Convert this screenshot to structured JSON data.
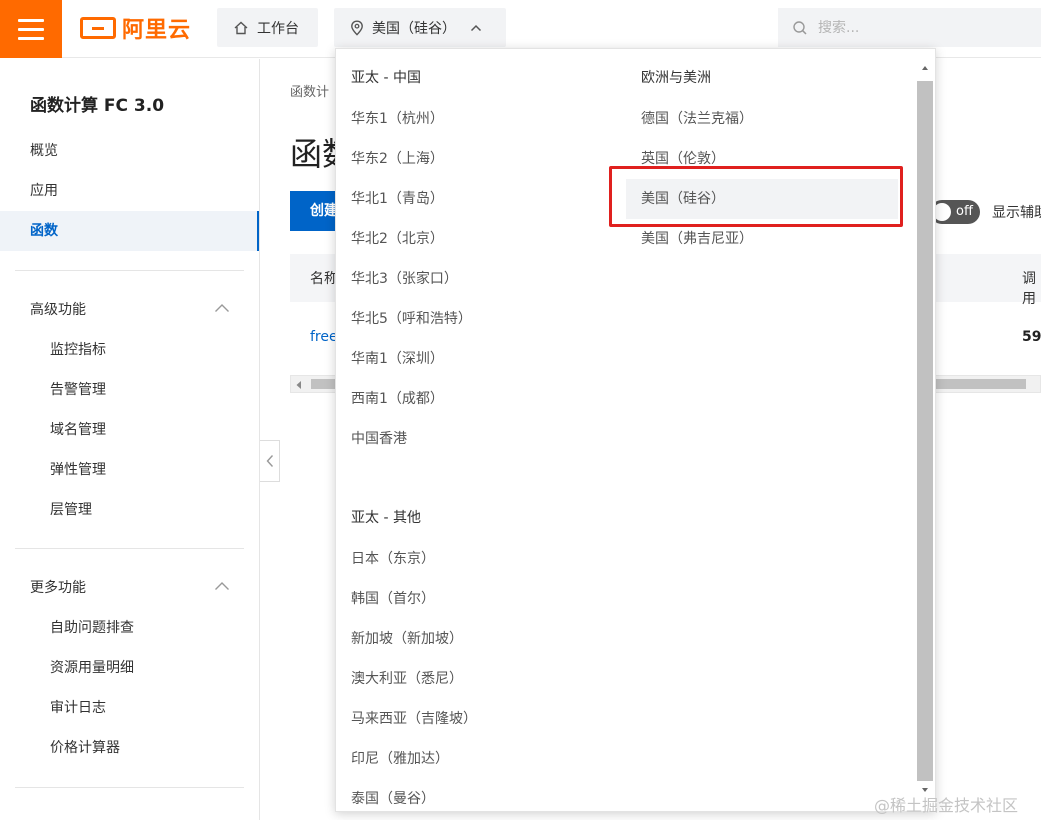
{
  "brand": {
    "name": "阿里云",
    "color": "#ff6a00"
  },
  "topbar": {
    "workbench_label": "工作台",
    "region_label": "美国（硅谷）",
    "search_placeholder": "搜索..."
  },
  "sidebar": {
    "title": "函数计算 FC 3.0",
    "items": [
      {
        "label": "概览",
        "active": false
      },
      {
        "label": "应用",
        "active": false
      },
      {
        "label": "函数",
        "active": true
      }
    ],
    "groups": [
      {
        "label": "高级功能",
        "items": [
          "监控指标",
          "告警管理",
          "域名管理",
          "弹性管理",
          "层管理"
        ]
      },
      {
        "label": "更多功能",
        "items": [
          "自助问题排查",
          "资源用量明细",
          "审计日志",
          "价格计算器"
        ]
      }
    ]
  },
  "main": {
    "breadcrumb": "函数计",
    "page_title": "函数",
    "create_button": "创建",
    "toggle_state": "off",
    "toggle_label": "显示辅助",
    "table_header_name": "名称",
    "table_header_calls": "调用",
    "row_name": "free",
    "row_value": "59"
  },
  "region_dropdown": {
    "left_groups": [
      {
        "title": "亚太 - 中国",
        "regions": [
          "华东1（杭州）",
          "华东2（上海）",
          "华北1（青岛）",
          "华北2（北京）",
          "华北3（张家口）",
          "华北5（呼和浩特）",
          "华南1（深圳）",
          "西南1（成都）",
          "中国香港"
        ]
      },
      {
        "title": "亚太 - 其他",
        "regions": [
          "日本（东京）",
          "韩国（首尔）",
          "新加坡（新加坡）",
          "澳大利亚（悉尼）",
          "马来西亚（吉隆坡）",
          "印尼（雅加达）",
          "泰国（曼谷）"
        ]
      }
    ],
    "right_groups": [
      {
        "title": "欧洲与美洲",
        "regions": [
          "德国（法兰克福）",
          "英国（伦敦）",
          "美国（硅谷）",
          "美国（弗吉尼亚）"
        ]
      }
    ],
    "selected": "美国（硅谷）"
  },
  "watermark": "@稀土掘金技术社区",
  "colors": {
    "accent": "#0064c8",
    "highlight": "#e0201e"
  }
}
